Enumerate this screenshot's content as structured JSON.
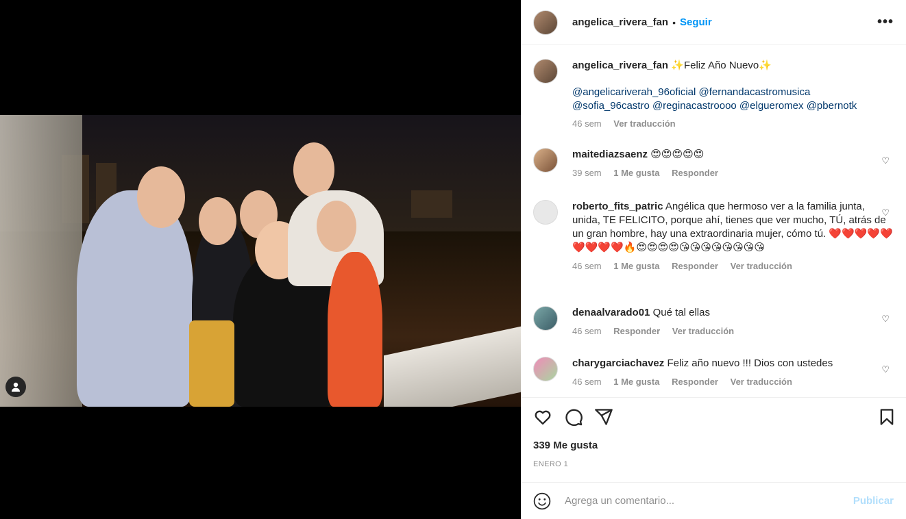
{
  "post": {
    "username": "angelica_rivera_fan",
    "follow_label": "Seguir",
    "dot": "•",
    "more_label": "•••"
  },
  "caption": {
    "username": "angelica_rivera_fan",
    "text": "✨Feliz Año Nuevo✨",
    "mentions_line1": "@angelicariverah_96oficial @fernandacastromusica",
    "mentions_line2": "@sofia_96castro @reginacastroooo @elgueromex @pbernotk",
    "time": "46 sem",
    "translate": "Ver traducción"
  },
  "comments": [
    {
      "username": "maitediazsaenz",
      "text": "😍😍😍😍😍",
      "time": "39 sem",
      "likes": "1 Me gusta",
      "reply": "Responder",
      "translate": ""
    },
    {
      "username": "roberto_fits_patric",
      "text": "Angélica que hermoso ver a la familia junta, unida, TE FELICITO, porque ahí, tienes que ver mucho, TÚ, atrás de un gran hombre, hay una extraordinaria mujer, cómo tú. ❤️❤️❤️❤️❤️❤️❤️❤️❤️🔥😍😍😍😍😘😘😘😘😘😘😘😘",
      "time": "46 sem",
      "likes": "1 Me gusta",
      "reply": "Responder",
      "translate": "Ver traducción"
    },
    {
      "username": "denaalvarado01",
      "text": "Qué tal ellas",
      "time": "46 sem",
      "likes": "",
      "reply": "Responder",
      "translate": "Ver traducción"
    },
    {
      "username": "charygarciachavez",
      "text": "Feliz año nuevo !!! Dios con ustedes",
      "time": "46 sem",
      "likes": "1 Me gusta",
      "reply": "Responder",
      "translate": "Ver traducción"
    }
  ],
  "likes_count": "339 Me gusta",
  "date": "ENERO 1",
  "add_comment": {
    "placeholder": "Agrega un comentario...",
    "publish": "Publicar"
  },
  "icons": [
    "heart-icon",
    "comment-icon",
    "share-icon",
    "bookmark-icon",
    "emoji-icon",
    "user-tag-icon",
    "more-icon"
  ]
}
